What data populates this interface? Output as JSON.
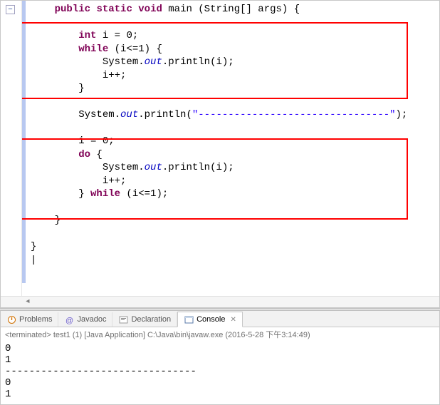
{
  "fold": {
    "symbol": "−"
  },
  "code": {
    "l1": {
      "indent": "    ",
      "kw1": "public",
      "kw2": "static",
      "kw3": "void",
      "name": " main (String[] args) {"
    },
    "l3": {
      "indent": "        ",
      "kw": "int",
      "rest": " i = 0;"
    },
    "l4": {
      "indent": "        ",
      "kw": "while",
      "rest": " (i<=1) {"
    },
    "l5": {
      "indent": "            System.",
      "fld": "out",
      "rest": ".println(i);"
    },
    "l6": "            i++;",
    "l7": "        }",
    "l9": {
      "indent": "        System.",
      "fld": "out",
      "rest1": ".println(",
      "str": "\"--------------------------------\"",
      "rest2": ");"
    },
    "l11": "        i = 0;",
    "l12": {
      "indent": "        ",
      "kw": "do",
      "rest": " {"
    },
    "l13": {
      "indent": "            System.",
      "fld": "out",
      "rest": ".println(i);"
    },
    "l14": "            i++;",
    "l15": {
      "indent": "        } ",
      "kw": "while",
      "rest": " (i<=1);"
    },
    "l17": "    }",
    "l19": "}",
    "cursor": "|"
  },
  "scroll": {
    "leftArrow": "◄"
  },
  "tabs": {
    "problems": {
      "label": "Problems"
    },
    "javadoc": {
      "label": "Javadoc"
    },
    "declaration": {
      "label": "Declaration"
    },
    "console": {
      "label": "Console",
      "close": "✕"
    }
  },
  "console": {
    "status": "<terminated> test1 (1) [Java Application] C:\\Java\\bin\\javaw.exe (2016-5-28 下午3:14:49)",
    "output": "0\n1\n--------------------------------\n0\n1"
  }
}
